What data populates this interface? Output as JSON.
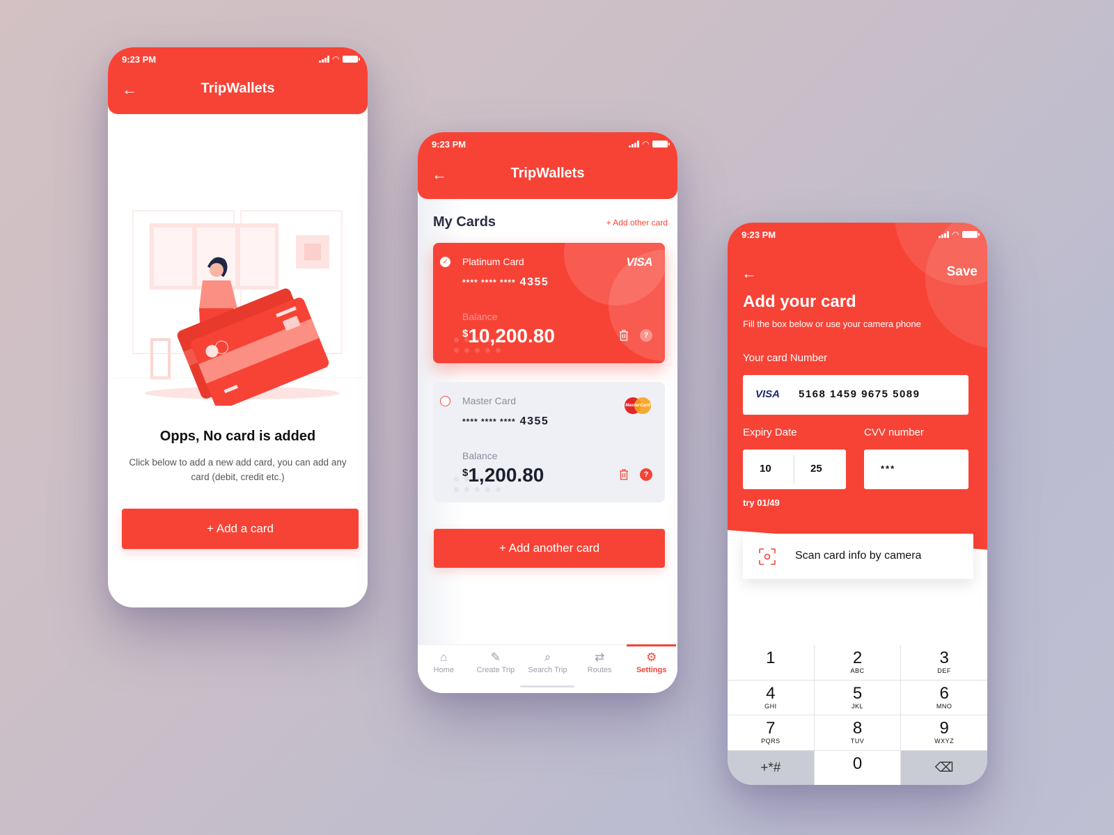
{
  "colors": {
    "brand": "#f74336",
    "text_dark": "#1d1f2e",
    "muted": "#8a8e9c",
    "card_inactive_bg": "#eef0f5"
  },
  "screen1": {
    "status_time": "9:23 PM",
    "app_title": "TripWallets",
    "back_icon": "arrow-left-icon",
    "empty_title": "Opps, No card is added",
    "empty_desc": "Click below to add a new add card, you can add any card (debit, credit etc.)",
    "add_button": "+ Add a card"
  },
  "screen2": {
    "status_time": "9:23 PM",
    "app_title": "TripWallets",
    "section_title": "My Cards",
    "add_other_link": "+ Add other card",
    "cards": [
      {
        "name": "Platinum Card",
        "number_mask": "**** **** ****",
        "last4": "4355",
        "balance_label": "Balance",
        "currency": "$",
        "balance": "10,200.80",
        "brand": "VISA",
        "selected": true
      },
      {
        "name": "Master Card",
        "number_mask": "**** **** ****",
        "last4": "4355",
        "balance_label": "Balance",
        "currency": "$",
        "balance": "1,200.80",
        "brand": "MasterCard",
        "selected": false
      }
    ],
    "add_another_button": "+ Add another card",
    "tabs": [
      {
        "label": "Home",
        "icon": "home-icon",
        "glyph": "⌂"
      },
      {
        "label": "Create Trip",
        "icon": "edit-icon",
        "glyph": "✎"
      },
      {
        "label": "Search Trip",
        "icon": "search-icon",
        "glyph": "⌕"
      },
      {
        "label": "Routes",
        "icon": "swap-icon",
        "glyph": "⇄"
      },
      {
        "label": "Settings",
        "icon": "gear-icon",
        "glyph": "⚙",
        "active": true
      }
    ]
  },
  "screen3": {
    "status_time": "9:23 PM",
    "save_label": "Save",
    "title": "Add your card",
    "subtitle": "Fill the box below or use your camera phone",
    "card_number_label": "Your card Number",
    "card_brand": "VISA",
    "card_number": "5168 1459 9675 5089",
    "expiry_label": "Expiry Date",
    "expiry_month": "10",
    "expiry_year": "25",
    "cvv_label": "CVV number",
    "cvv_value": "***",
    "try_counter": "try 01/49",
    "scan_label": "Scan card info by camera",
    "keypad": [
      {
        "digit": "1",
        "letters": ""
      },
      {
        "digit": "2",
        "letters": "ABC"
      },
      {
        "digit": "3",
        "letters": "DEF"
      },
      {
        "digit": "4",
        "letters": "GHI"
      },
      {
        "digit": "5",
        "letters": "JKL"
      },
      {
        "digit": "6",
        "letters": "MNO"
      },
      {
        "digit": "7",
        "letters": "PQRS"
      },
      {
        "digit": "8",
        "letters": "TUV"
      },
      {
        "digit": "9",
        "letters": "WXYZ"
      },
      {
        "digit": "+*#",
        "letters": ""
      },
      {
        "digit": "0",
        "letters": ""
      },
      {
        "digit": "⌫",
        "letters": ""
      }
    ]
  }
}
